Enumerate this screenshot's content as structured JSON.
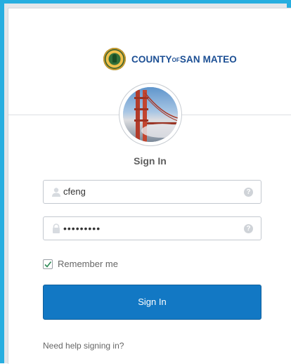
{
  "branding": {
    "county_label": "COUNTY",
    "of_label": "OF",
    "name_label": "SAN MATEO"
  },
  "form": {
    "title": "Sign In",
    "username_value": "cfeng",
    "password_value": "•••••••••",
    "remember_label": "Remember me",
    "remember_checked": true,
    "submit_label": "Sign In",
    "help_link": "Need help signing in?"
  },
  "colors": {
    "accent_border": "#27aee0",
    "primary_button": "#1278c4",
    "logo_text": "#1c4f94"
  },
  "icons": {
    "username": "user-icon",
    "password": "lock-icon",
    "field_help": "question-icon",
    "checkbox": "checkmark-icon"
  }
}
